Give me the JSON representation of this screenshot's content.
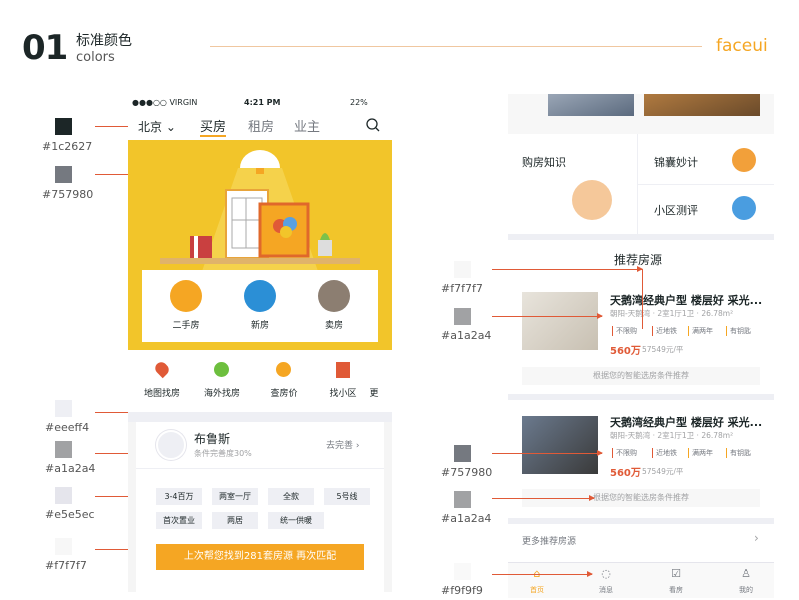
{
  "header": {
    "number": "01",
    "title_cn": "标准颜色",
    "title_en": "colors",
    "brand": "faceui"
  },
  "swatches_left": [
    {
      "hex": "#1c2627",
      "label": "#1c2627"
    },
    {
      "hex": "#757980",
      "label": "#757980"
    },
    {
      "hex": "#eeeff4",
      "label": "#eeeff4"
    },
    {
      "hex": "#a1a2a4",
      "label": "#a1a2a4"
    },
    {
      "hex": "#e5e5ec",
      "label": "#e5e5ec"
    },
    {
      "hex": "#f7f7f7",
      "label": "#f7f7f7"
    }
  ],
  "swatches_right": [
    {
      "hex": "#f7f7f7",
      "label": "#f7f7f7"
    },
    {
      "hex": "#a1a2a4",
      "label": "#a1a2a4"
    },
    {
      "hex": "#757980",
      "label": "#757980"
    },
    {
      "hex": "#a1a2a4",
      "label": "#a1a2a4"
    },
    {
      "hex": "#f9f9f9",
      "label": "#f9f9f9"
    }
  ],
  "left_phone": {
    "status": {
      "carrier": "●●●○○ VIRGIN",
      "time": "4:21 PM",
      "battery": "22%"
    },
    "nav": {
      "city": "北京",
      "tabs": [
        "买房",
        "租房",
        "业主"
      ]
    },
    "categories": [
      "二手房",
      "新房",
      "卖房"
    ],
    "quick": [
      "地图找房",
      "海外找房",
      "查房价",
      "找小区",
      "更"
    ],
    "profile": {
      "name": "布鲁斯",
      "completeness": "条件完善度30%",
      "action": "去完善"
    },
    "chips_row1": [
      "3-4百万",
      "两室一厅",
      "全款",
      "5号线"
    ],
    "chips_row2": [
      "首次置业",
      "两居",
      "统一供暖"
    ],
    "cta": "上次帮您找到281套房源  再次匹配"
  },
  "right_phone": {
    "tiles": {
      "knowledge": "购房知识",
      "tips": "锦囊妙计",
      "evaluate": "小区测评"
    },
    "section_title": "推荐房源",
    "listings": [
      {
        "title": "天鹅湾经典户型 楼层好 采光...",
        "sub": "朝阳-天鹅湾 · 2室1厅1卫 · 26.78m²",
        "tags": [
          "不限购",
          "近地铁",
          "满两年",
          "有钥匙"
        ],
        "price": "560万",
        "unit_price": "57549元/平"
      },
      {
        "title": "天鹅湾经典户型 楼层好 采光...",
        "sub": "朝阳-天鹅湾 · 2室1厅1卫 · 26.78m²",
        "tags": [
          "不限购",
          "近地铁",
          "满两年",
          "有钥匙"
        ],
        "price": "560万",
        "unit_price": "57549元/平"
      }
    ],
    "recommend_hint": "根据您的智能选房条件推荐",
    "more": "更多推荐房源",
    "tabbar": [
      "首页",
      "消息",
      "看房",
      "我的"
    ]
  },
  "colors": {
    "accent": "#f5a623",
    "red": "#e05a37",
    "yellow": "#f2c52a"
  }
}
